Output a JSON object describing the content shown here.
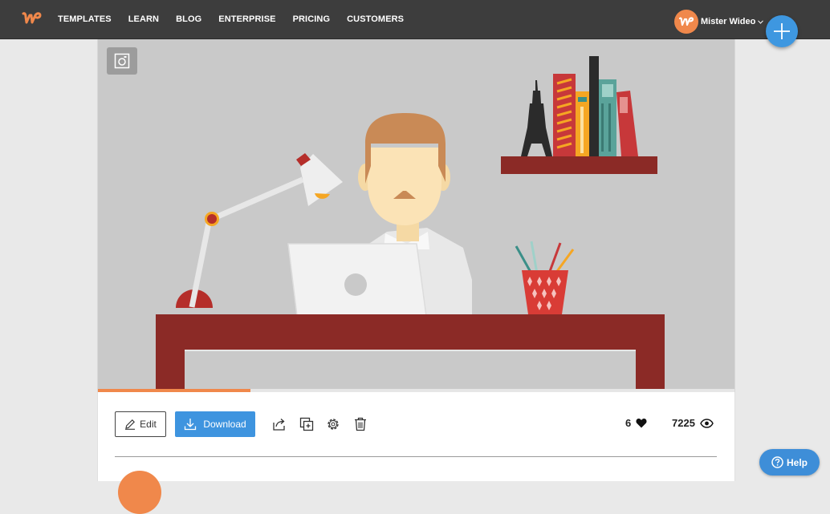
{
  "nav": {
    "items": [
      "TEMPLATES",
      "LEARN",
      "BLOG",
      "ENTERPRISE",
      "PRICING",
      "CUSTOMERS"
    ]
  },
  "user": {
    "name": "Mister Wideo",
    "avatar_letter": "w"
  },
  "player": {
    "progress_fraction": 0.24
  },
  "actions": {
    "edit_label": "Edit",
    "download_label": "Download"
  },
  "stats": {
    "likes": "6",
    "views": "7225"
  },
  "help": {
    "label": "Help"
  },
  "colors": {
    "brand_orange": "#f0884b",
    "accent_blue": "#3e94df",
    "topbar": "#3d3d3d"
  },
  "icons": [
    "wideo-logo-icon",
    "chevron-down-icon",
    "plus-icon",
    "snapshot-icon",
    "pencil-icon",
    "download-icon",
    "share-icon",
    "duplicate-icon",
    "gear-icon",
    "trash-icon",
    "heart-icon",
    "eye-icon",
    "question-icon"
  ]
}
